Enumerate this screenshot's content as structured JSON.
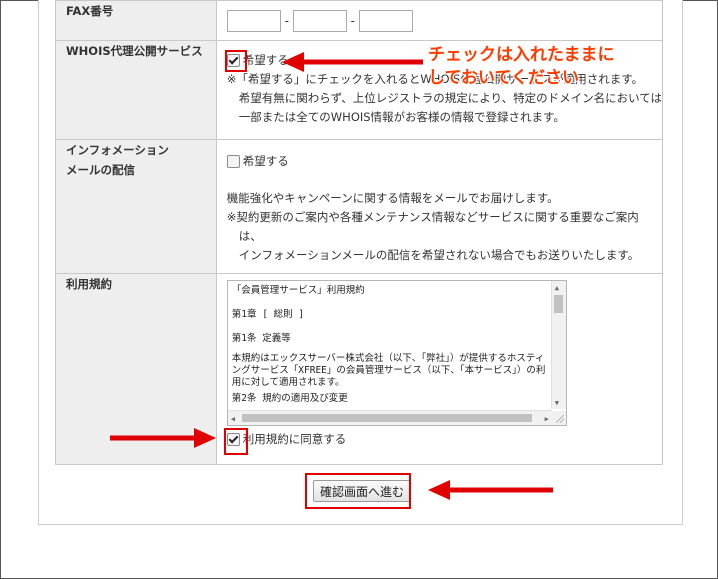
{
  "form": {
    "fax": {
      "label": "FAX番号",
      "field1": "",
      "field2": "",
      "field3": "",
      "separator": "-"
    },
    "whois": {
      "label": "WHOIS代理公開サービス",
      "checkbox_label": "希望する",
      "checked": true,
      "notes": [
        "※「希望する」にチェックを入れるとWHOIS代理公開サービスが適用されます。",
        "希望有無に関わらず、上位レジストラの規定により、特定のドメイン名においては",
        "一部または全てのWHOIS情報がお客様の情報で登録されます。"
      ]
    },
    "info_mail": {
      "label_line1": "インフォメーション",
      "label_line2": "メールの配信",
      "checkbox_label": "希望する",
      "checked": false,
      "notes": [
        "機能強化やキャンペーンに関する情報をメールでお届けします。",
        "※契約更新のご案内や各種メンテナンス情報などサービスに関する重要なご案内",
        "は、",
        "インフォメーションメールの配信を希望されない場合でもお送りいたします。"
      ]
    },
    "terms": {
      "label": "利用規約",
      "text": [
        "「会員管理サービス」利用規約",
        "第1章 [ 総則 ]",
        "第1条 定義等",
        "本規約はエックスサーバー株式会社（以下、「弊社」）が提供するホスティングサービス「XFREE」の会員管理サービス（以下、「本サービス」）の利用に対して適用されます。",
        "第2条 規約の適用及び変更"
      ],
      "agree_label": "利用規約に同意する",
      "agree_checked": true
    },
    "confirm_button": "確認画面へ進む"
  },
  "annotation": {
    "line1": "チェックは入れたままに",
    "line2": "しておいてください",
    "color": "#e00000"
  }
}
